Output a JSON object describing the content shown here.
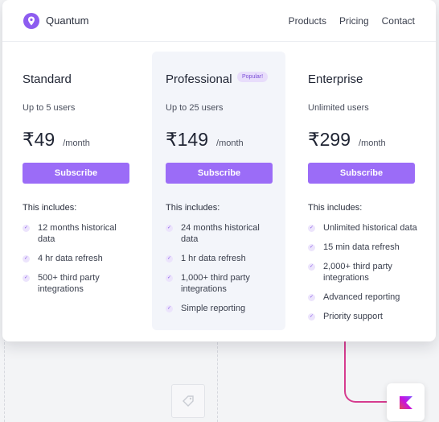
{
  "header": {
    "brand": "Quantum",
    "nav": [
      "Products",
      "Pricing",
      "Contact"
    ]
  },
  "plans": [
    {
      "name": "Standard",
      "badge": "",
      "subtitle": "Up to 5 users",
      "price": "₹49",
      "period": "/month",
      "cta": "Subscribe",
      "includes_label": "This includes:",
      "features": [
        "12 months historical data",
        "4 hr data refresh",
        "500+ third party integrations"
      ]
    },
    {
      "name": "Professional",
      "badge": "Popular!",
      "subtitle": "Up to 25 users",
      "price": "₹149",
      "period": "/month",
      "cta": "Subscribe",
      "includes_label": "This includes:",
      "features": [
        "24 months historical data",
        "1 hr data refresh",
        "1,000+ third party integrations",
        "Simple reporting"
      ]
    },
    {
      "name": "Enterprise",
      "badge": "",
      "subtitle": "Unlimited users",
      "price": "₹299",
      "period": "/month",
      "cta": "Subscribe",
      "includes_label": "This includes:",
      "features": [
        "Unlimited historical data",
        "15 min data refresh",
        "2,000+ third party integrations",
        "Advanced reporting",
        "Priority support"
      ]
    }
  ],
  "icons": {
    "brand": "location-pin-logo-icon",
    "check": "check-icon",
    "ghost": "tag-icon",
    "app": "kotlin-logo-icon"
  },
  "colors": {
    "accent": "#9b6cf7",
    "badge_bg": "#e8ddfb",
    "badge_text": "#7b4fd6",
    "highlight_bg": "#f3f5fa",
    "connector": "#d63c8f"
  }
}
